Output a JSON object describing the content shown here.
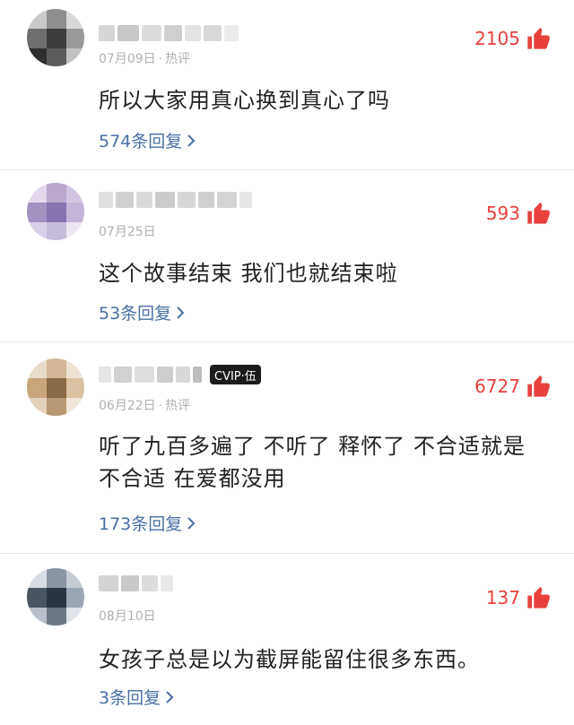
{
  "comments": [
    {
      "date": "07月09日",
      "tag": "热评",
      "likes": "2105",
      "text": "所以大家用真心换到真心了吗",
      "replies": "574条回复"
    },
    {
      "date": "07月25日",
      "tag": "",
      "likes": "593",
      "text": "这个故事结束 我们也就结束啦",
      "replies": "53条回复"
    },
    {
      "date": "06月22日",
      "tag": "热评",
      "likes": "6727",
      "vip_badge": "CVIP·伍",
      "text": "听了九百多遍了 不听了 释怀了 不合适就是不合适 在爱都没用",
      "replies": "173条回复"
    },
    {
      "date": "08月10日",
      "tag": "",
      "likes": "137",
      "text": "女孩子总是以为截屏能留住很多东西。",
      "replies": "3条回复"
    }
  ],
  "colors": {
    "like_red": "#e8413c",
    "reply_blue": "#4a6fa5",
    "meta_gray": "#b0b0b0"
  },
  "icons": {
    "like": "thumbs-up-icon",
    "expand": "chevron-right-icon"
  }
}
